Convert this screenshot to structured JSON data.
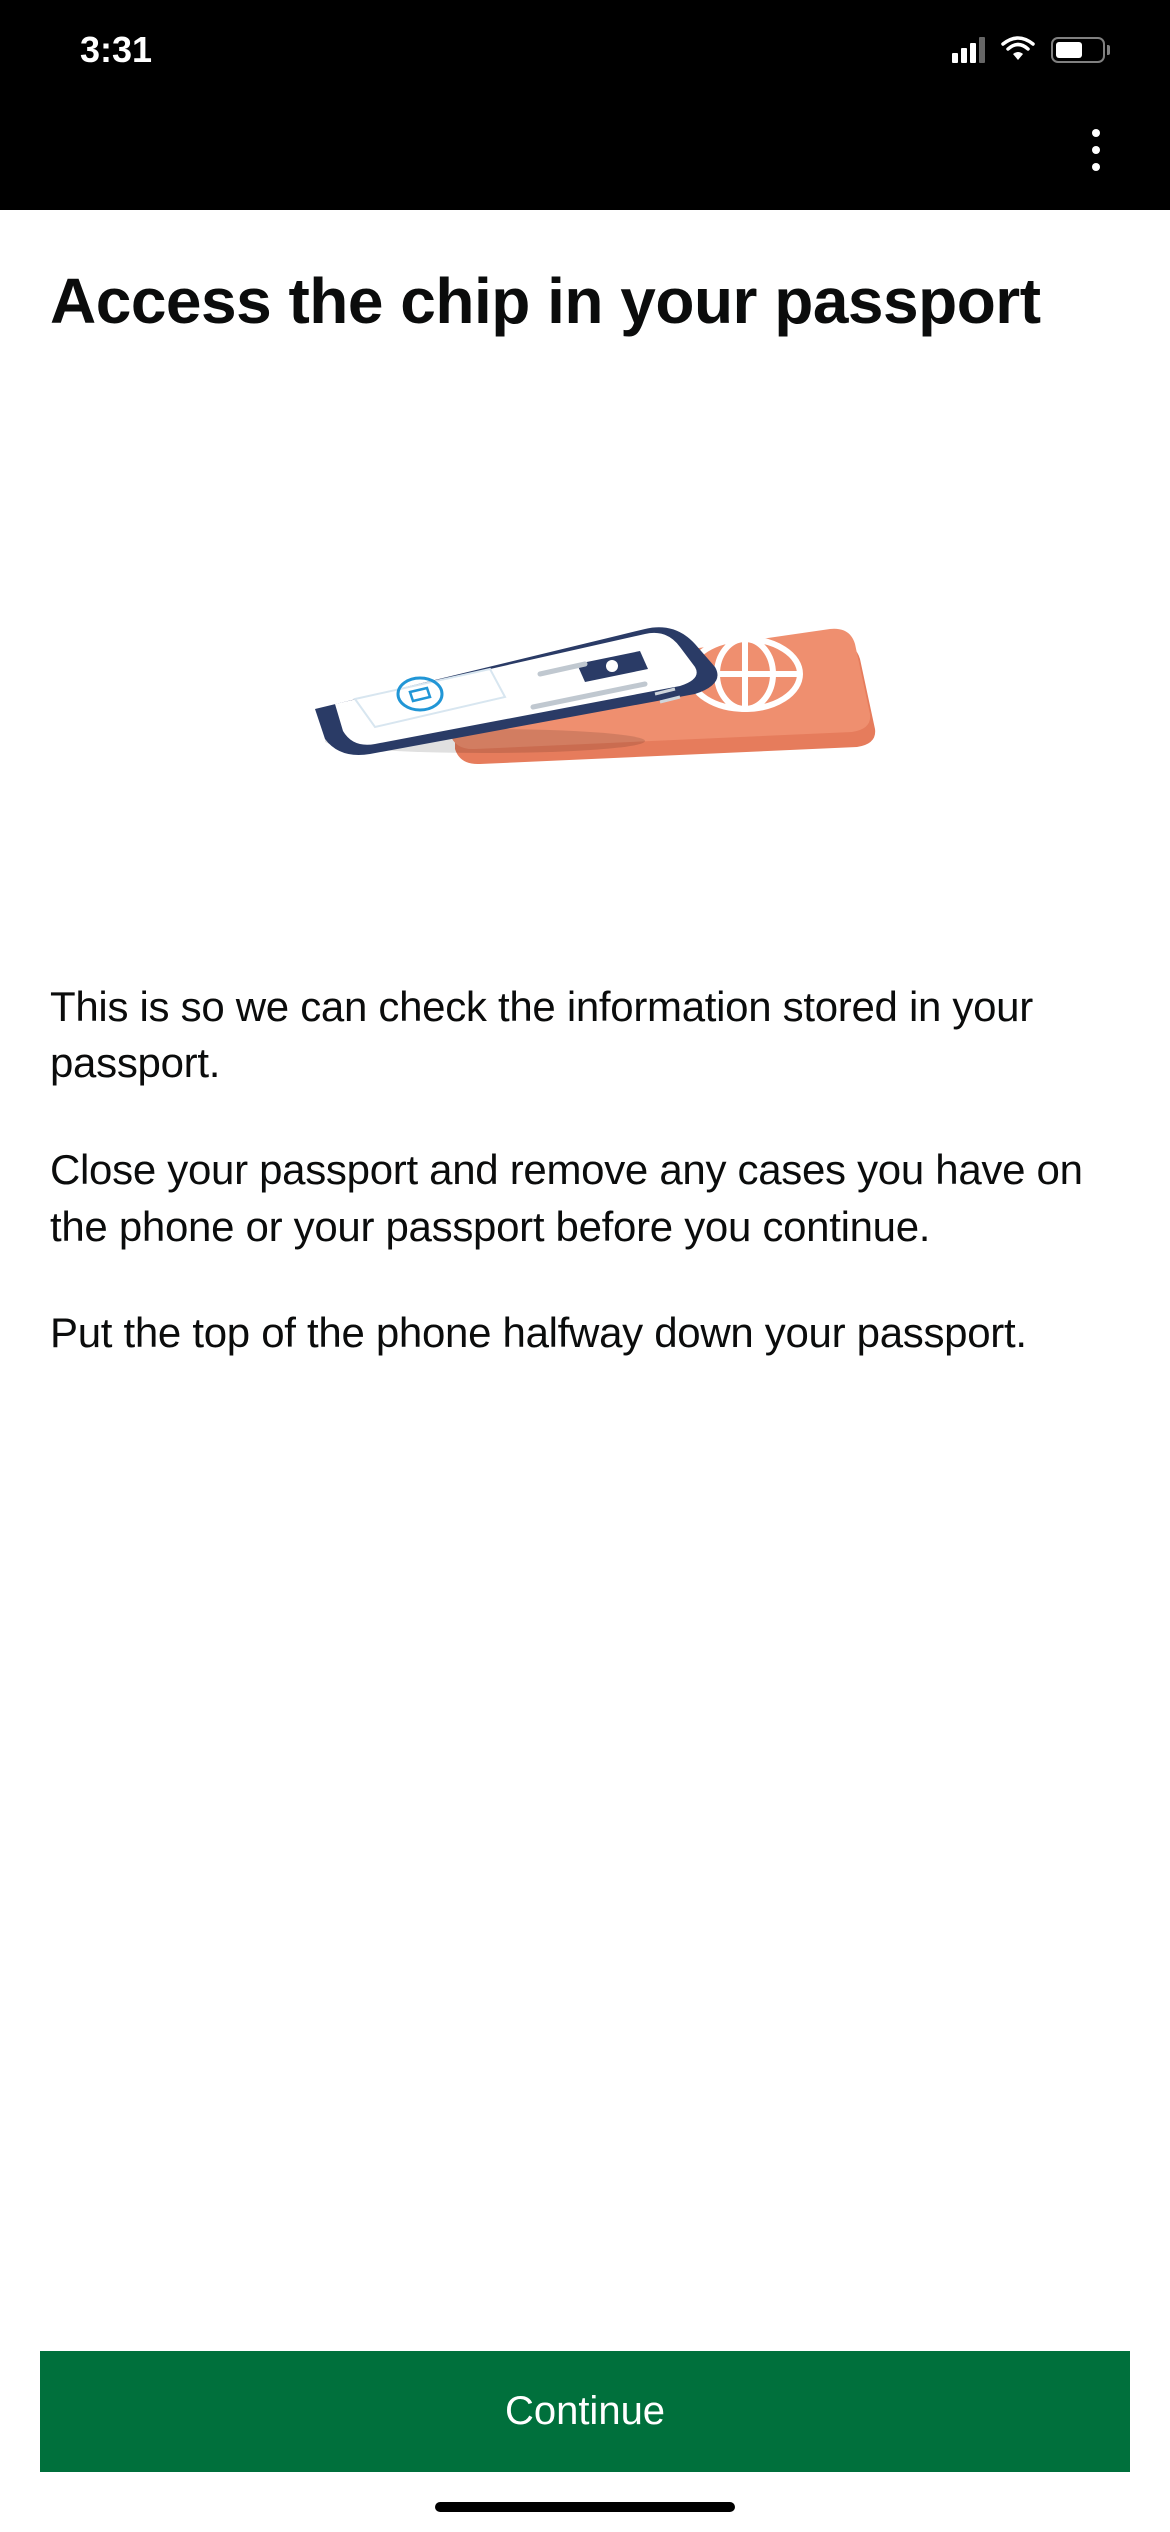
{
  "statusBar": {
    "time": "3:31"
  },
  "page": {
    "title": "Access the chip in your passport",
    "paragraph1": "This is so we can check the information stored in your passport.",
    "paragraph2": "Close your passport and remove any cases you have on the phone or your passport before you continue.",
    "paragraph3": "Put the top of the phone halfway down your passport."
  },
  "actions": {
    "continueLabel": "Continue"
  },
  "illustration": {
    "description": "Phone placed on top of a closed passport"
  }
}
